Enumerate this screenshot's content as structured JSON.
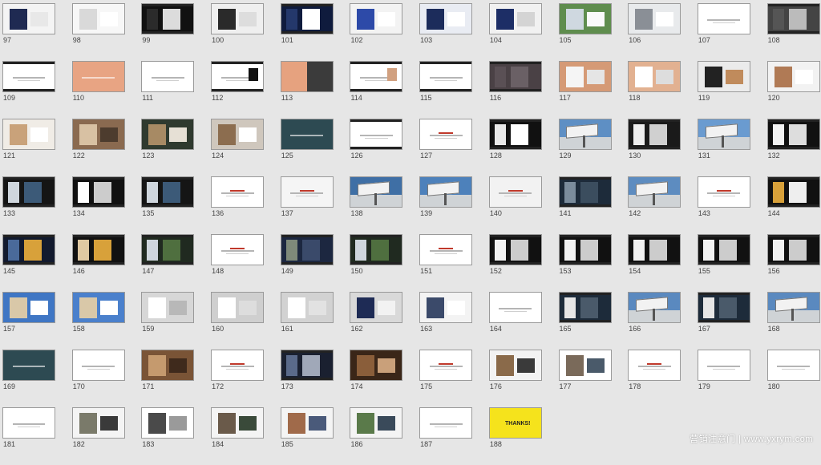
{
  "slides": [
    {
      "n": "97",
      "s": "photo",
      "c": [
        "#f4f4f4",
        "#1f2a52",
        "#e8e8e8"
      ]
    },
    {
      "n": "98",
      "s": "photo",
      "c": [
        "#f7f7f7",
        "#d9d9d9",
        "#ffffff"
      ]
    },
    {
      "n": "99",
      "s": "dark",
      "c": [
        "#111111",
        "#2b2b2b",
        "#dcdcdc"
      ]
    },
    {
      "n": "100",
      "s": "photo",
      "c": [
        "#efefef",
        "#2a2a2a",
        "#dddddd"
      ]
    },
    {
      "n": "101",
      "s": "dark",
      "c": [
        "#0f1b3d",
        "#24386b",
        "#ffffff"
      ]
    },
    {
      "n": "102",
      "s": "photo",
      "c": [
        "#f3f3f3",
        "#2d4aa8",
        "#ffffff"
      ]
    },
    {
      "n": "103",
      "s": "photo",
      "c": [
        "#e9ecf3",
        "#1c2c5b",
        "#ffffff"
      ]
    },
    {
      "n": "104",
      "s": "photo",
      "c": [
        "#f1f1f1",
        "#1d2e66",
        "#d4d4d4"
      ]
    },
    {
      "n": "105",
      "s": "photo",
      "c": [
        "#5f8d4e",
        "#cfd8e0",
        "#fafafa"
      ]
    },
    {
      "n": "106",
      "s": "photo",
      "c": [
        "#e8eaec",
        "#8a8f96",
        "#ffffff"
      ]
    },
    {
      "n": "107",
      "s": "plain",
      "c": [
        "#ffffff"
      ]
    },
    {
      "n": "108",
      "s": "dark",
      "c": [
        "#444444",
        "#555555",
        "#bbbbbb"
      ]
    },
    {
      "n": "109",
      "s": "bars",
      "c": [
        "#ffffff"
      ]
    },
    {
      "n": "110",
      "s": "solid",
      "c": [
        "#e8a483"
      ]
    },
    {
      "n": "111",
      "s": "plain",
      "c": [
        "#ffffff"
      ]
    },
    {
      "n": "112",
      "s": "bars",
      "c": [
        "#ffffff",
        "#111111"
      ]
    },
    {
      "n": "113",
      "s": "split",
      "c": [
        "#e6a27f",
        "#3b3b3b"
      ]
    },
    {
      "n": "114",
      "s": "bars",
      "c": [
        "#ffffff",
        "#d1a07f"
      ]
    },
    {
      "n": "115",
      "s": "bars",
      "c": [
        "#ffffff"
      ]
    },
    {
      "n": "116",
      "s": "dark",
      "c": [
        "#4a4145",
        "#5a5055",
        "#6a6065"
      ]
    },
    {
      "n": "117",
      "s": "photo",
      "c": [
        "#d59a76",
        "#f5f5f5",
        "#e5e5e5"
      ]
    },
    {
      "n": "118",
      "s": "photo",
      "c": [
        "#e2b191",
        "#ffffff",
        "#dddddd"
      ]
    },
    {
      "n": "119",
      "s": "photo",
      "c": [
        "#ebebeb",
        "#222222",
        "#c08b5c"
      ]
    },
    {
      "n": "120",
      "s": "photo",
      "c": [
        "#f2f2f2",
        "#b07a55",
        "#ffffff"
      ]
    },
    {
      "n": "121",
      "s": "photo",
      "c": [
        "#f0ece6",
        "#c9a27a",
        "#ffffff"
      ]
    },
    {
      "n": "122",
      "s": "photo",
      "c": [
        "#8a6a50",
        "#d8c1a3",
        "#4d3c2e"
      ]
    },
    {
      "n": "123",
      "s": "photo",
      "c": [
        "#2f3a2f",
        "#a78a64",
        "#e6e0d5"
      ]
    },
    {
      "n": "124",
      "s": "photo",
      "c": [
        "#cfc7bd",
        "#8c6d4f",
        "#ffffff"
      ]
    },
    {
      "n": "125",
      "s": "solid",
      "c": [
        "#2d4a52"
      ]
    },
    {
      "n": "126",
      "s": "bars",
      "c": [
        "#ffffff"
      ]
    },
    {
      "n": "127",
      "s": "red",
      "c": [
        "#ffffff"
      ]
    },
    {
      "n": "128",
      "s": "dark",
      "c": [
        "#111111",
        "#e9e9e9",
        "#ffffff"
      ]
    },
    {
      "n": "129",
      "s": "billboard",
      "c": [
        "#5e8fc4",
        "#eeeeee"
      ]
    },
    {
      "n": "130",
      "s": "dark",
      "c": [
        "#1a1a1a",
        "#eeeeee",
        "#d0d0d0"
      ]
    },
    {
      "n": "131",
      "s": "billboard",
      "c": [
        "#6a9bd0",
        "#eeeeee"
      ]
    },
    {
      "n": "132",
      "s": "dark",
      "c": [
        "#111111",
        "#f4f4f4",
        "#dddddd"
      ]
    },
    {
      "n": "133",
      "s": "dark",
      "c": [
        "#151515",
        "#cfd6dd",
        "#3c5a78"
      ]
    },
    {
      "n": "134",
      "s": "dark",
      "c": [
        "#111111",
        "#ffffff",
        "#cccccc"
      ]
    },
    {
      "n": "135",
      "s": "dark",
      "c": [
        "#151515",
        "#cfd6dd",
        "#3c5a78"
      ]
    },
    {
      "n": "136",
      "s": "red",
      "c": [
        "#ffffff"
      ]
    },
    {
      "n": "137",
      "s": "red",
      "c": [
        "#f5f5f5"
      ]
    },
    {
      "n": "138",
      "s": "billboard",
      "c": [
        "#3f6fa5",
        "#e6e6e6"
      ]
    },
    {
      "n": "139",
      "s": "billboard",
      "c": [
        "#4d81bb",
        "#e6e6e6"
      ]
    },
    {
      "n": "140",
      "s": "red",
      "c": [
        "#f2f2f2"
      ]
    },
    {
      "n": "141",
      "s": "dark",
      "c": [
        "#1d2b3a",
        "#7b8c9c",
        "#3b4d5e"
      ]
    },
    {
      "n": "142",
      "s": "billboard",
      "c": [
        "#5d8cc0",
        "#eeeeee"
      ]
    },
    {
      "n": "143",
      "s": "red",
      "c": [
        "#ffffff"
      ]
    },
    {
      "n": "144",
      "s": "dark",
      "c": [
        "#111111",
        "#d8a13a",
        "#eeeeee"
      ]
    },
    {
      "n": "145",
      "s": "dark",
      "c": [
        "#121a2e",
        "#4a6a9a",
        "#d8a13a"
      ]
    },
    {
      "n": "146",
      "s": "dark",
      "c": [
        "#111111",
        "#e0c9a2",
        "#d8a13a"
      ]
    },
    {
      "n": "147",
      "s": "dark",
      "c": [
        "#202a20",
        "#cfd6dd",
        "#4f6f3f"
      ]
    },
    {
      "n": "148",
      "s": "red",
      "c": [
        "#ffffff"
      ]
    },
    {
      "n": "149",
      "s": "dark",
      "c": [
        "#1c2740",
        "#7f8a7a",
        "#3a4a6a"
      ]
    },
    {
      "n": "150",
      "s": "dark",
      "c": [
        "#202a20",
        "#cfd6dd",
        "#4f6f3f"
      ]
    },
    {
      "n": "151",
      "s": "red",
      "c": [
        "#ffffff"
      ]
    },
    {
      "n": "152",
      "s": "dark",
      "c": [
        "#111111",
        "#f2f2f2",
        "#cccccc"
      ]
    },
    {
      "n": "153",
      "s": "dark",
      "c": [
        "#111111",
        "#f2f2f2",
        "#cccccc"
      ]
    },
    {
      "n": "154",
      "s": "dark",
      "c": [
        "#111111",
        "#f2f2f2",
        "#cccccc"
      ]
    },
    {
      "n": "155",
      "s": "dark",
      "c": [
        "#111111",
        "#f2f2f2",
        "#cccccc"
      ]
    },
    {
      "n": "156",
      "s": "dark",
      "c": [
        "#111111",
        "#f2f2f2",
        "#cccccc"
      ]
    },
    {
      "n": "157",
      "s": "photo",
      "c": [
        "#3f76c4",
        "#d9c8a8",
        "#ffffff"
      ]
    },
    {
      "n": "158",
      "s": "photo",
      "c": [
        "#4a80cc",
        "#d9c8a8",
        "#ffffff"
      ]
    },
    {
      "n": "159",
      "s": "photo",
      "c": [
        "#d7d7d7",
        "#ffffff",
        "#b8b8b8"
      ]
    },
    {
      "n": "160",
      "s": "photo",
      "c": [
        "#cfcfcf",
        "#ffffff",
        "#dddddd"
      ]
    },
    {
      "n": "161",
      "s": "photo",
      "c": [
        "#d2d2d2",
        "#ffffff",
        "#e2e2e2"
      ]
    },
    {
      "n": "162",
      "s": "photo",
      "c": [
        "#d9d9d9",
        "#1e2b55",
        "#f2f2f2"
      ]
    },
    {
      "n": "163",
      "s": "photo",
      "c": [
        "#f3f3f3",
        "#3b4a6a",
        "#ffffff"
      ]
    },
    {
      "n": "164",
      "s": "plain",
      "c": [
        "#ffffff"
      ]
    },
    {
      "n": "165",
      "s": "dark",
      "c": [
        "#1d2b3a",
        "#e6e6e6",
        "#4a5a6a"
      ]
    },
    {
      "n": "166",
      "s": "billboard",
      "c": [
        "#5a89bf",
        "#eeeeee"
      ]
    },
    {
      "n": "167",
      "s": "dark",
      "c": [
        "#1d2b3a",
        "#e6e6e6",
        "#4a5a6a"
      ]
    },
    {
      "n": "168",
      "s": "billboard",
      "c": [
        "#5a89bf",
        "#eeeeee"
      ]
    },
    {
      "n": "169",
      "s": "solid",
      "c": [
        "#2d4a52"
      ]
    },
    {
      "n": "170",
      "s": "plain",
      "c": [
        "#ffffff"
      ]
    },
    {
      "n": "171",
      "s": "photo",
      "c": [
        "#7a5436",
        "#c59a6e",
        "#3f2a1c"
      ]
    },
    {
      "n": "172",
      "s": "red",
      "c": [
        "#ffffff"
      ]
    },
    {
      "n": "173",
      "s": "dark",
      "c": [
        "#1a2030",
        "#5a6a8a",
        "#a0a8b8"
      ]
    },
    {
      "n": "174",
      "s": "photo",
      "c": [
        "#3a2618",
        "#8a5e3a",
        "#c9a07a"
      ]
    },
    {
      "n": "175",
      "s": "red",
      "c": [
        "#ffffff"
      ]
    },
    {
      "n": "176",
      "s": "photo",
      "c": [
        "#f3f3f3",
        "#8a6a4a",
        "#3a3a3a"
      ]
    },
    {
      "n": "177",
      "s": "photo",
      "c": [
        "#ffffff",
        "#7a6a5a",
        "#4a5a6a"
      ]
    },
    {
      "n": "178",
      "s": "red",
      "c": [
        "#ffffff"
      ]
    },
    {
      "n": "179",
      "s": "plain",
      "c": [
        "#ffffff"
      ]
    },
    {
      "n": "180",
      "s": "plain",
      "c": [
        "#ffffff"
      ]
    },
    {
      "n": "181",
      "s": "plain",
      "c": [
        "#ffffff"
      ]
    },
    {
      "n": "182",
      "s": "photo",
      "c": [
        "#f4f4f4",
        "#7a7a6a",
        "#3a3a3a"
      ]
    },
    {
      "n": "183",
      "s": "photo",
      "c": [
        "#ffffff",
        "#4a4a4a",
        "#9a9a9a"
      ]
    },
    {
      "n": "184",
      "s": "photo",
      "c": [
        "#f4f4f4",
        "#6a5a4a",
        "#3a4a3a"
      ]
    },
    {
      "n": "185",
      "s": "photo",
      "c": [
        "#f4f4f4",
        "#a06a4a",
        "#4a5a7a"
      ]
    },
    {
      "n": "186",
      "s": "photo",
      "c": [
        "#f4f4f4",
        "#5a7a4a",
        "#3a4a5a"
      ]
    },
    {
      "n": "187",
      "s": "plain",
      "c": [
        "#ffffff"
      ]
    },
    {
      "n": "188",
      "s": "yellow",
      "c": [
        "#f5e31c"
      ],
      "text": "THANKS!"
    }
  ],
  "watermark": "营销注意门 | www.yxrym.com",
  "colors": {
    "background": "#e6e6e6",
    "accent_red": "#c0392b"
  }
}
